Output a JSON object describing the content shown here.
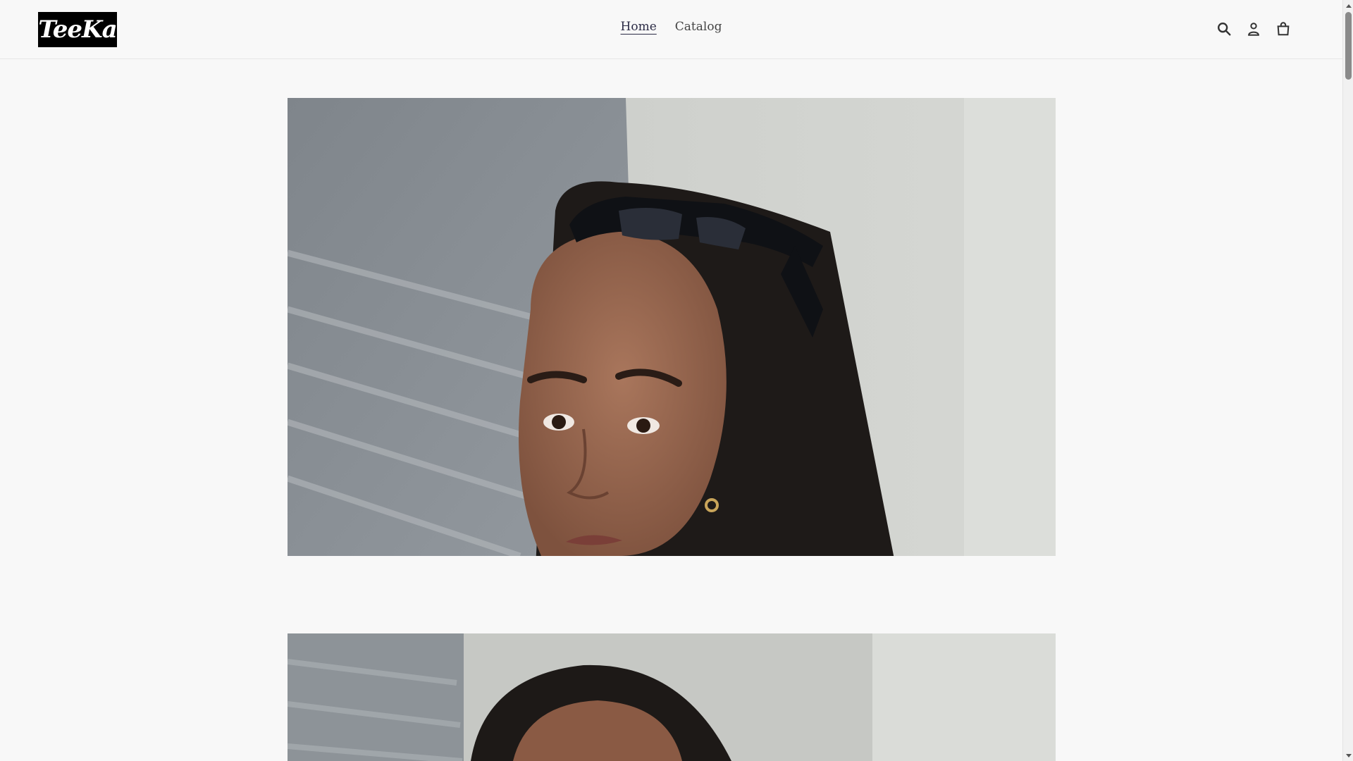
{
  "brand": {
    "logo_text": "TeeKa"
  },
  "nav": {
    "items": [
      {
        "label": "Home",
        "active": true
      },
      {
        "label": "Catalog",
        "active": false
      }
    ]
  },
  "header_icons": [
    "search-icon",
    "account-icon",
    "cart-icon"
  ],
  "colors": {
    "background": "#f8f8f8",
    "logo_bg": "#000000",
    "logo_text": "#ffffff",
    "nav_active": "#2b2b45"
  },
  "images": [
    {
      "subject": "woman with sunglasses on head in front of gray wall"
    },
    {
      "subject": "woman with dark hair in front of gray and white wall"
    }
  ]
}
